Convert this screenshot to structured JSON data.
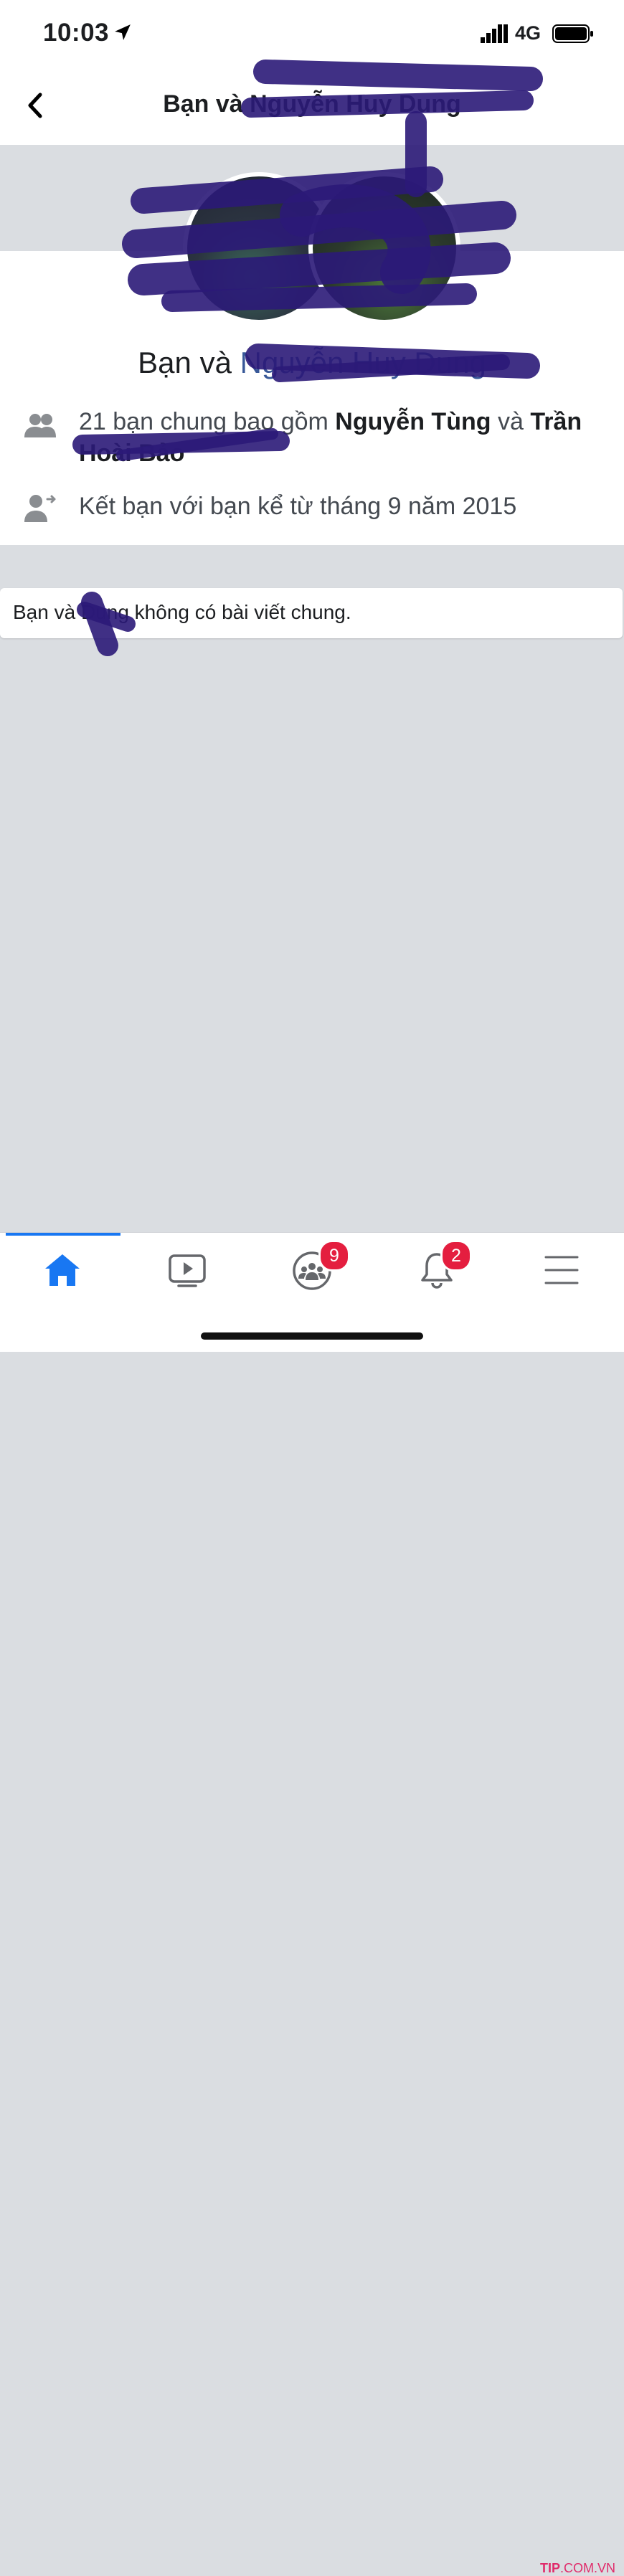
{
  "status": {
    "time": "10:03",
    "network": "4G"
  },
  "nav": {
    "title": "Bạn và Nguyễn Huy Dung",
    "back_icon": "chevron-left-icon"
  },
  "profile": {
    "pair_prefix": "Bạn và ",
    "pair_friend": "Nguyễn Huy Dung"
  },
  "info": {
    "mutual": {
      "icon": "friends-icon",
      "prefix": "21 bạn chung bao gồm ",
      "name1": "Nguyễn Tùng",
      "join": " và ",
      "name2": "Trần Hoài Bảo"
    },
    "since": {
      "icon": "add-friend-icon",
      "text": "Kết bạn với bạn kể từ tháng 9 năm 2015"
    }
  },
  "posts": {
    "empty_text": "Bạn và Dung không có bài viết chung."
  },
  "tabs": [
    {
      "name": "home",
      "icon": "home-icon",
      "active": true
    },
    {
      "name": "watch",
      "icon": "video-icon",
      "active": false
    },
    {
      "name": "groups",
      "icon": "groups-icon",
      "badge": "9"
    },
    {
      "name": "notifications",
      "icon": "bell-icon",
      "badge": "2"
    },
    {
      "name": "menu",
      "icon": "menu-icon"
    }
  ],
  "watermark": {
    "brand": "TIP",
    "domain": ".COM.VN"
  },
  "colors": {
    "accent": "#1877f2",
    "badge": "#e41e3f",
    "scribble": "#2b1a78"
  }
}
